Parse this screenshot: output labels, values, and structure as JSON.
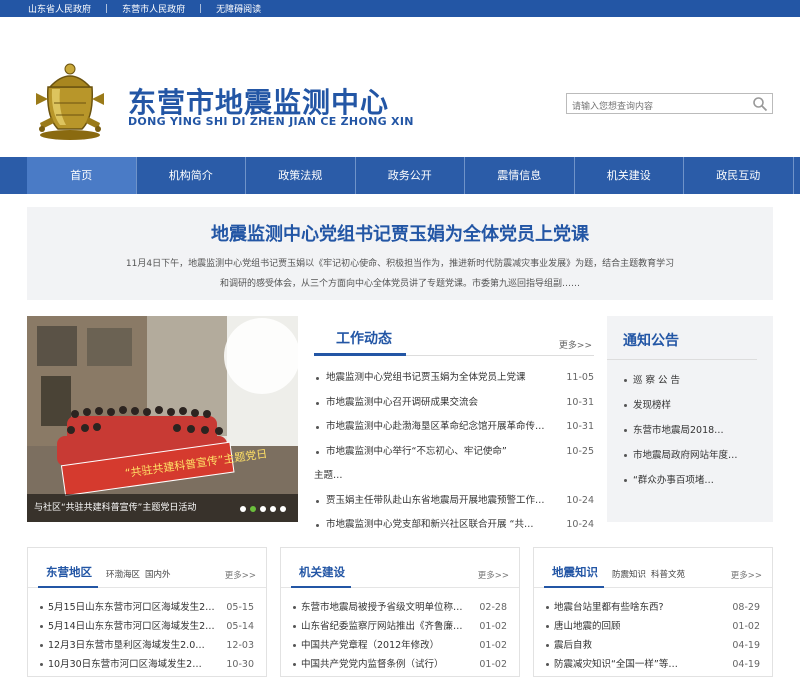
{
  "topbar": {
    "links": [
      "山东省人民政府",
      "东营市人民政府",
      "无障碍阅读"
    ],
    "sep": "|"
  },
  "site": {
    "title_zh": "东营市地震监测中心",
    "title_en": "DONG YING SHI DI ZHEN JIAN CE ZHONG XIN"
  },
  "search": {
    "placeholder": "请输入您想查询内容"
  },
  "nav": [
    "首页",
    "机构简介",
    "政策法规",
    "政务公开",
    "震情信息",
    "机关建设",
    "政民互动"
  ],
  "hero": {
    "title": "地震监测中心党组书记贾玉娟为全体党员上党课",
    "line1": "11月4日下午，地震监测中心党组书记贾玉娟以《牢记初心使命、积极担当作为，推进新时代防震减灾事业发展》为题，结合主题教育学习",
    "line2": "和调研的感受体会，从三个方面向中心全体党员讲了专题党课。市委第九巡回指导组副……"
  },
  "photo": {
    "caption": "与社区“共驻共建科普宣传”主题党日活动",
    "banner_text": "“共驻共建科普宣传”主题党日"
  },
  "work": {
    "title": "工作动态",
    "more": "更多>>",
    "items": [
      {
        "text": "地震监测中心党组书记贾玉娟为全体党员上党课",
        "date": "11-05"
      },
      {
        "text": "市地震监测中心召开调研成果交流会",
        "date": "10-31"
      },
      {
        "text": "市地震监测中心赴渤海垦区革命纪念馆开展革命传…",
        "date": "10-31"
      },
      {
        "text": "市地震监测中心举行“不忘初心、牢记使命”",
        "date": "10-25"
      },
      {
        "text": "主题…",
        "date": ""
      },
      {
        "text": "贾玉娟主任带队赴山东省地震局开展地震预警工作…",
        "date": "10-24"
      },
      {
        "text": "市地震监测中心党支部和新兴社区联合开展 “共…",
        "date": "10-24"
      }
    ]
  },
  "notice": {
    "title": "通知公告",
    "items": [
      "巡 察 公 告",
      "发现榜样",
      "东营市地震局2018…",
      "市地震局政府网站年度…",
      "“群众办事百项堵…"
    ]
  },
  "boxes": [
    {
      "title": "东营地区",
      "subs": [
        "环渤海区",
        "国内外"
      ],
      "more": "更多>>",
      "items": [
        {
          "text": "5月15日山东东营市河口区海域发生2…",
          "date": "05-15"
        },
        {
          "text": "5月14日山东东营市河口区海域发生2…",
          "date": "05-14"
        },
        {
          "text": "12月3日东营市垦利区海域发生2.0…",
          "date": "12-03"
        },
        {
          "text": "10月30日东营市河口区海域发生2…",
          "date": "10-30"
        }
      ]
    },
    {
      "title": "机关建设",
      "subs": [],
      "more": "更多>>",
      "items": [
        {
          "text": "东营市地震局被授予省级文明单位称…",
          "date": "02-28"
        },
        {
          "text": "山东省纪委监察厅网站推出《齐鲁廉…",
          "date": "01-02"
        },
        {
          "text": "中国共产党章程（2012年修改）",
          "date": "01-02"
        },
        {
          "text": "中国共产党党内监督条例（试行）",
          "date": "01-02"
        }
      ]
    },
    {
      "title": "地震知识",
      "subs": [
        "防震知识",
        "科普文苑"
      ],
      "more": "更多>>",
      "items": [
        {
          "text": "地震台站里都有些啥东西?",
          "date": "08-29"
        },
        {
          "text": "唐山地震的回顾",
          "date": "01-02"
        },
        {
          "text": "震后自救",
          "date": "04-19"
        },
        {
          "text": "防震减灾知识“全国一样”等…",
          "date": "04-19"
        }
      ]
    }
  ],
  "colors": {
    "brand": "#2356a5",
    "nav": "#2b5ca8",
    "nav_active": "#4a7bc6",
    "panel": "#f2f3f5"
  },
  "icons": {
    "search": "search-icon",
    "logo": "seismograph-emblem-icon"
  }
}
